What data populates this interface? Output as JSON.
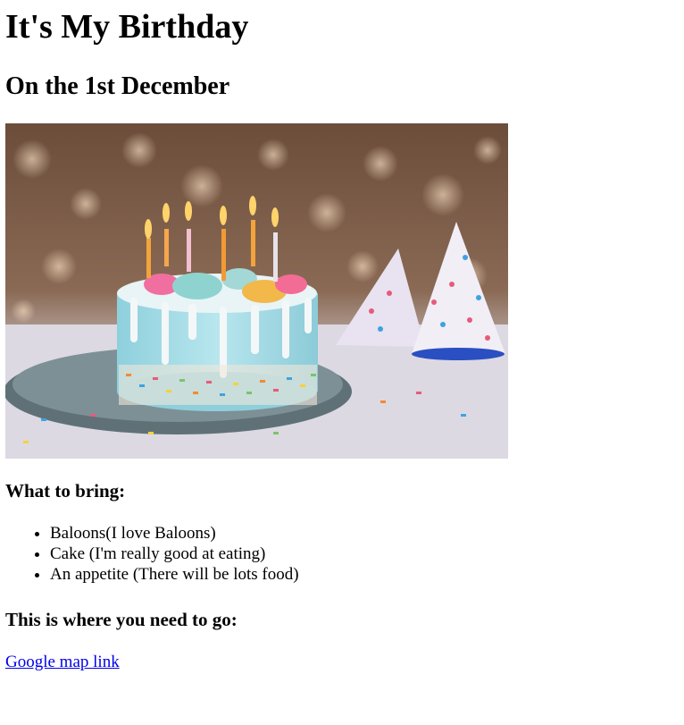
{
  "heading": "It's My Birthday",
  "subheading": "On the 1st December",
  "image": {
    "name": "birthday-cake-photo"
  },
  "bring": {
    "title": "What to bring:",
    "items": [
      "Baloons(I love Baloons)",
      "Cake (I'm really good at eating)",
      "An appetite (There will be lots food)"
    ]
  },
  "location": {
    "title": "This is where you need to go:",
    "link_text": "Google map link"
  },
  "colors": {
    "link": "#0000ee",
    "cake_frosting": "#a9dfe8",
    "plate": "#6f8389"
  }
}
